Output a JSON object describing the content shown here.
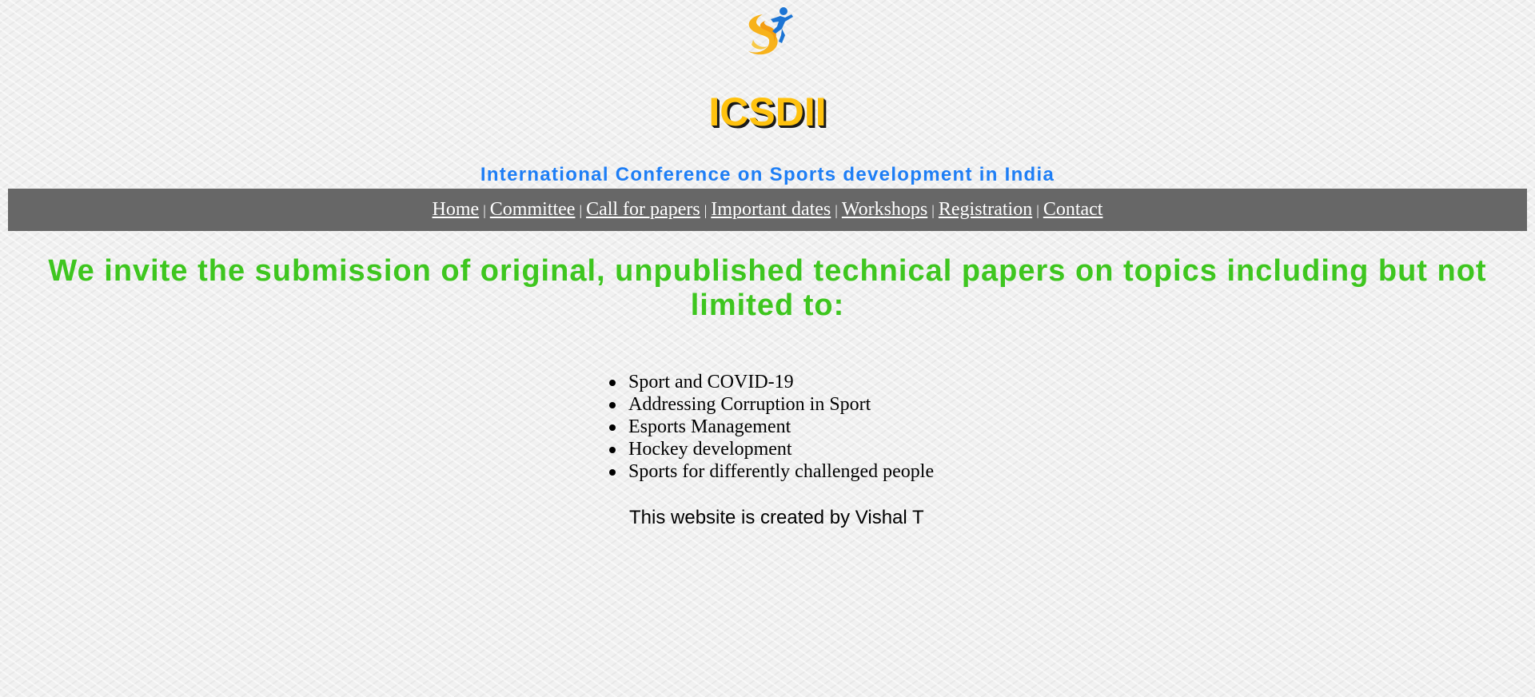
{
  "header": {
    "title": "ICSDII",
    "subtitle": "International Conference on Sports development in India"
  },
  "nav": {
    "items": [
      {
        "label": "Home"
      },
      {
        "label": "Committee"
      },
      {
        "label": "Call for papers"
      },
      {
        "label": "Important dates"
      },
      {
        "label": "Workshops"
      },
      {
        "label": "Registration"
      },
      {
        "label": "Contact"
      }
    ],
    "separator": "|"
  },
  "main": {
    "headline": "We invite the submission of original, unpublished technical papers on topics including but not limited to:",
    "topics": [
      "Sport and COVID-19",
      "Addressing Corruption in Sport",
      "Esports Management",
      "Hockey development",
      "Sports for differently challenged people"
    ]
  },
  "footer": {
    "credit": "This website is created by Vishal T"
  },
  "colors": {
    "title": "#ffc20e",
    "subtitle": "#1e7ef5",
    "navbar_bg": "#676767",
    "headline": "#3ec61f"
  },
  "icons": {
    "logo": "sports-runner-logo-icon"
  }
}
